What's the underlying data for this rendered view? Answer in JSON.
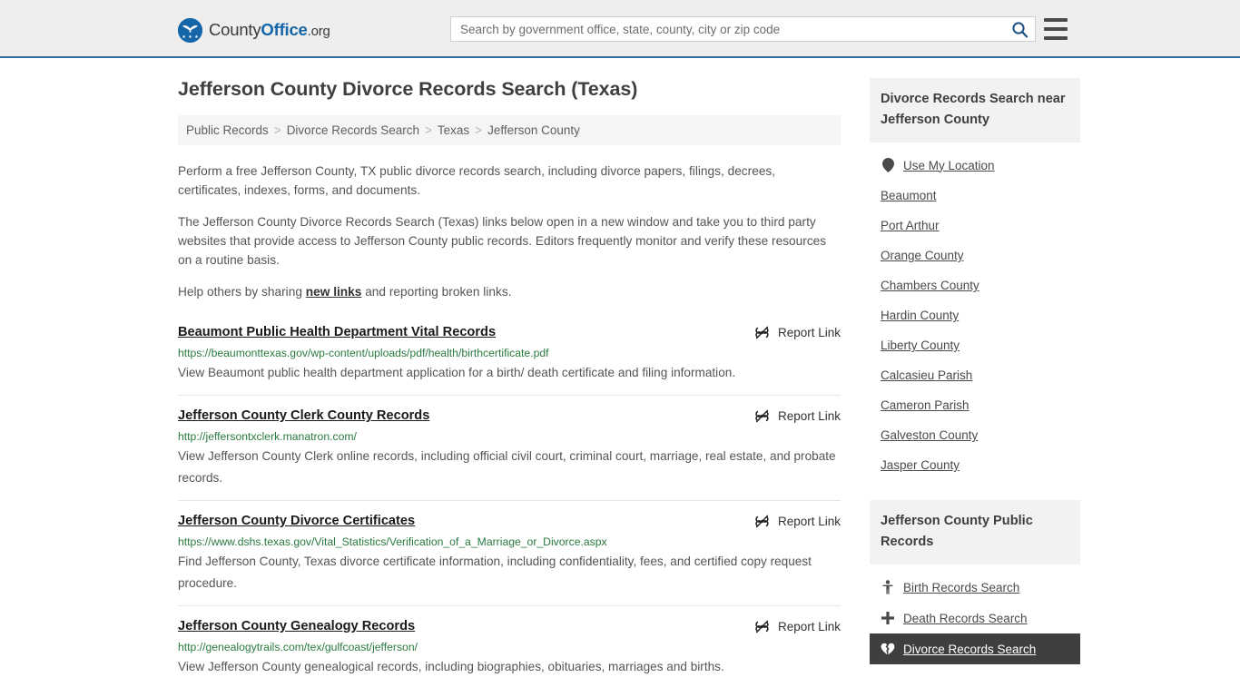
{
  "header": {
    "brand": {
      "part1": "County",
      "part2": "Office",
      "part3": ".org",
      "logo_icon": "eagle-seal-icon"
    },
    "search": {
      "value": "",
      "placeholder": "Search by government office, state, county, city or zip code",
      "button_icon": "search-icon"
    },
    "menu_icon": "hamburger-menu-icon"
  },
  "main": {
    "title": "Jefferson County Divorce Records Search (Texas)",
    "breadcrumb": [
      {
        "label": "Public Records"
      },
      {
        "label": "Divorce Records Search"
      },
      {
        "label": "Texas"
      },
      {
        "label": "Jefferson County"
      }
    ],
    "breadcrumb_separator": ">",
    "intro": {
      "p1": "Perform a free Jefferson County, TX public divorce records search, including divorce papers, filings, decrees, certificates, indexes, forms, and documents.",
      "p2": "The Jefferson County Divorce Records Search (Texas) links below open in a new window and take you to third party websites that provide access to Jefferson County public records. Editors frequently monitor and verify these resources on a routine basis.",
      "p3_before": "Help others by sharing ",
      "p3_link": "new links",
      "p3_after": " and reporting broken links."
    },
    "report_link_label": "Report Link",
    "report_link_icon": "broken-link-icon",
    "results": [
      {
        "title": "Beaumont Public Health Department Vital Records",
        "url": "https://beaumonttexas.gov/wp-content/uploads/pdf/health/birthcertificate.pdf",
        "description": "View Beaumont public health department application for a birth/ death certificate and filing information."
      },
      {
        "title": "Jefferson County Clerk County Records",
        "url": "http://jeffersontxclerk.manatron.com/",
        "description": "View Jefferson County Clerk online records, including official civil court, criminal court, marriage, real estate, and probate records."
      },
      {
        "title": "Jefferson County Divorce Certificates",
        "url": "https://www.dshs.texas.gov/Vital_Statistics/Verification_of_a_Marriage_or_Divorce.aspx",
        "description": "Find Jefferson County, Texas divorce certificate information, including confidentiality, fees, and certified copy request procedure."
      },
      {
        "title": "Jefferson County Genealogy Records",
        "url": "http://genealogytrails.com/tex/gulfcoast/jefferson/",
        "description": "View Jefferson County genealogical records, including biographies, obituaries, marriages and births."
      }
    ]
  },
  "sidebar": {
    "nearby": {
      "heading": "Divorce Records Search near Jefferson County",
      "use_my_location": {
        "label": "Use My Location",
        "icon": "map-pin-icon"
      },
      "items": [
        {
          "label": "Beaumont"
        },
        {
          "label": "Port Arthur"
        },
        {
          "label": "Orange County"
        },
        {
          "label": "Chambers County"
        },
        {
          "label": "Hardin County"
        },
        {
          "label": "Liberty County"
        },
        {
          "label": "Calcasieu Parish"
        },
        {
          "label": "Cameron Parish"
        },
        {
          "label": "Galveston County"
        },
        {
          "label": "Jasper County"
        }
      ]
    },
    "public_records": {
      "heading": "Jefferson County Public Records",
      "items": [
        {
          "label": "Birth Records Search",
          "icon": "baby-icon",
          "active": false
        },
        {
          "label": "Death Records Search",
          "icon": "plus-cross-icon",
          "active": false
        },
        {
          "label": "Divorce Records Search",
          "icon": "broken-heart-icon",
          "active": true
        }
      ]
    }
  },
  "colors": {
    "brand_blue": "#1566a8",
    "header_bg": "#eeeeee",
    "header_border": "#2f6ca3",
    "url_green": "#2a7a3f",
    "panel_bg": "#f2f2f2",
    "active_bg": "#3f3f3f"
  }
}
